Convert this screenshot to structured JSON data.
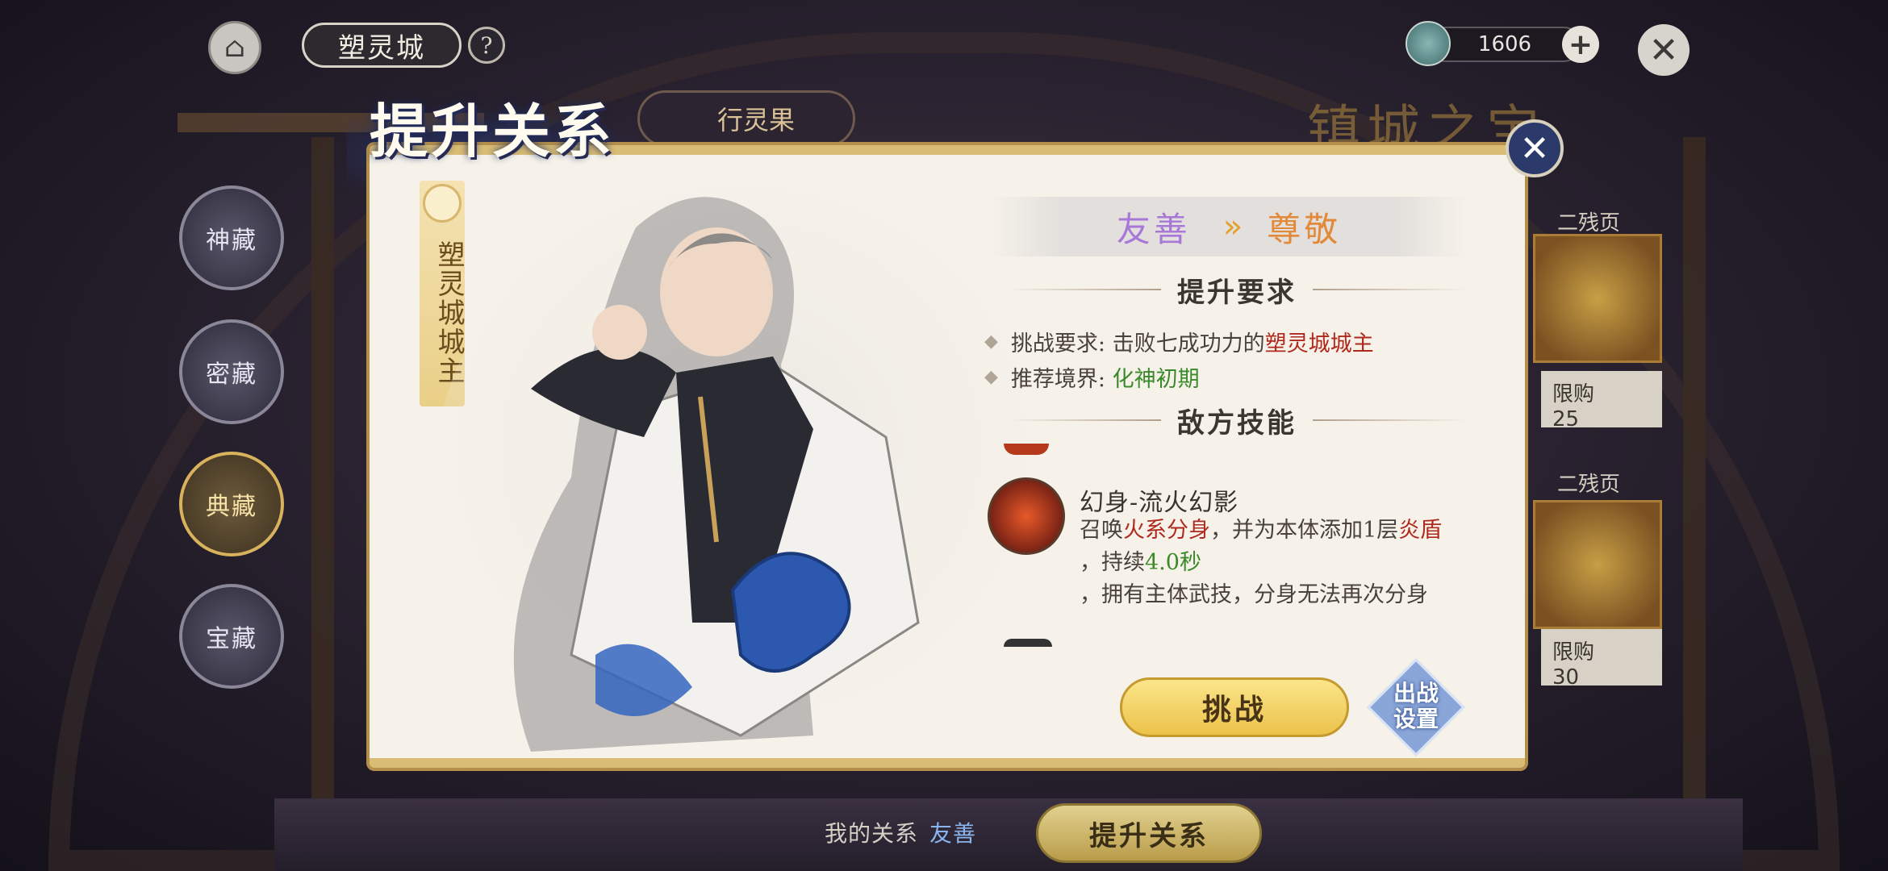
{
  "header": {
    "city_name": "塑灵城",
    "help_icon": "?",
    "currency_value": "1606",
    "plus_icon": "+",
    "close_icon": "✕"
  },
  "left_nav": {
    "items": [
      {
        "label": "神藏",
        "active": false
      },
      {
        "label": "密藏",
        "active": false
      },
      {
        "label": "典藏",
        "active": true
      },
      {
        "label": "宝藏",
        "active": false
      }
    ]
  },
  "background": {
    "tab_label": "行灵果",
    "right_title": "镇城之宝",
    "side_labels": [
      "二残页",
      "限购",
      "二残页",
      "限购"
    ],
    "side_prices": [
      "25",
      "30"
    ]
  },
  "modal": {
    "title": "提升关系",
    "close_icon": "✕",
    "character_name": "塑灵城城主",
    "relation_from": "友善",
    "relation_arrow": "»",
    "relation_to": "尊敬",
    "requirements_header": "提升要求",
    "requirements": [
      {
        "label": "挑战要求:",
        "text": "击败七成功力的",
        "highlight": "塑灵城城主"
      },
      {
        "label": "推荐境界:",
        "text": "",
        "highlight": "化神初期"
      }
    ],
    "skills_header": "敌方技能",
    "skill": {
      "name": "幻身-流火幻影",
      "desc_1a": "召唤",
      "desc_1b": "火系分身",
      "desc_1c": "，并为本体添加1层",
      "desc_1d": "炎盾",
      "desc_2a": "，持续",
      "desc_2b": "4.0秒",
      "desc_3": "，拥有主体武技，分身无法再次分身"
    },
    "challenge_label": "挑战",
    "deploy_label_1": "出战",
    "deploy_label_2": "设置"
  },
  "footer": {
    "relation_label": "我的关系",
    "relation_value": "友善",
    "upgrade_button": "提升关系"
  },
  "colors": {
    "relation_from": "#a878d8",
    "relation_to": "#e3893a",
    "highlight_red": "#b0291d",
    "highlight_green": "#3a8a2a",
    "gold": "#d9bd75"
  },
  "icons": {
    "home": "pagoda-icon",
    "currency": "spirit-avatar-icon",
    "help": "question-icon",
    "close": "close-icon",
    "relation_arrow": "double-chevron-icon"
  }
}
